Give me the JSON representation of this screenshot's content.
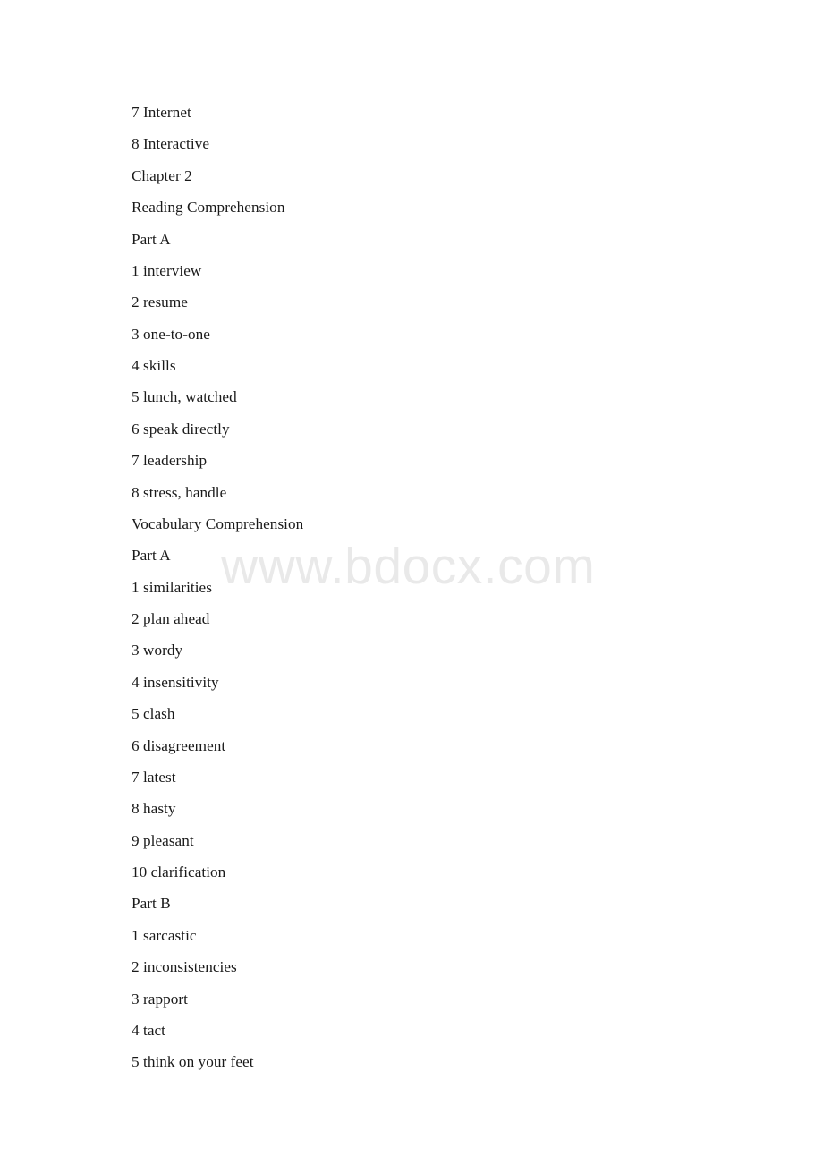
{
  "document": {
    "watermark": "www.bdocx.com",
    "lines": [
      "7 Internet",
      "8 Interactive",
      "Chapter 2",
      "Reading Comprehension",
      "Part A",
      "1 interview",
      "2 resume",
      "3 one-to-one",
      "4 skills",
      "5 lunch, watched",
      "6 speak directly",
      "7 leadership",
      "8 stress, handle",
      "Vocabulary Comprehension",
      "Part A",
      "1 similarities",
      "2 plan ahead",
      "3 wordy",
      "4 insensitivity",
      "5 clash",
      "6 disagreement",
      "7 latest",
      "8 hasty",
      "9 pleasant",
      "10 clarification",
      "Part B",
      "1 sarcastic",
      "2 inconsistencies",
      "3 rapport",
      "4 tact",
      "5 think on your feet"
    ],
    "colors": {
      "text": "#1a1a1a",
      "watermark": "#e9e9e9",
      "background": "#ffffff"
    }
  }
}
